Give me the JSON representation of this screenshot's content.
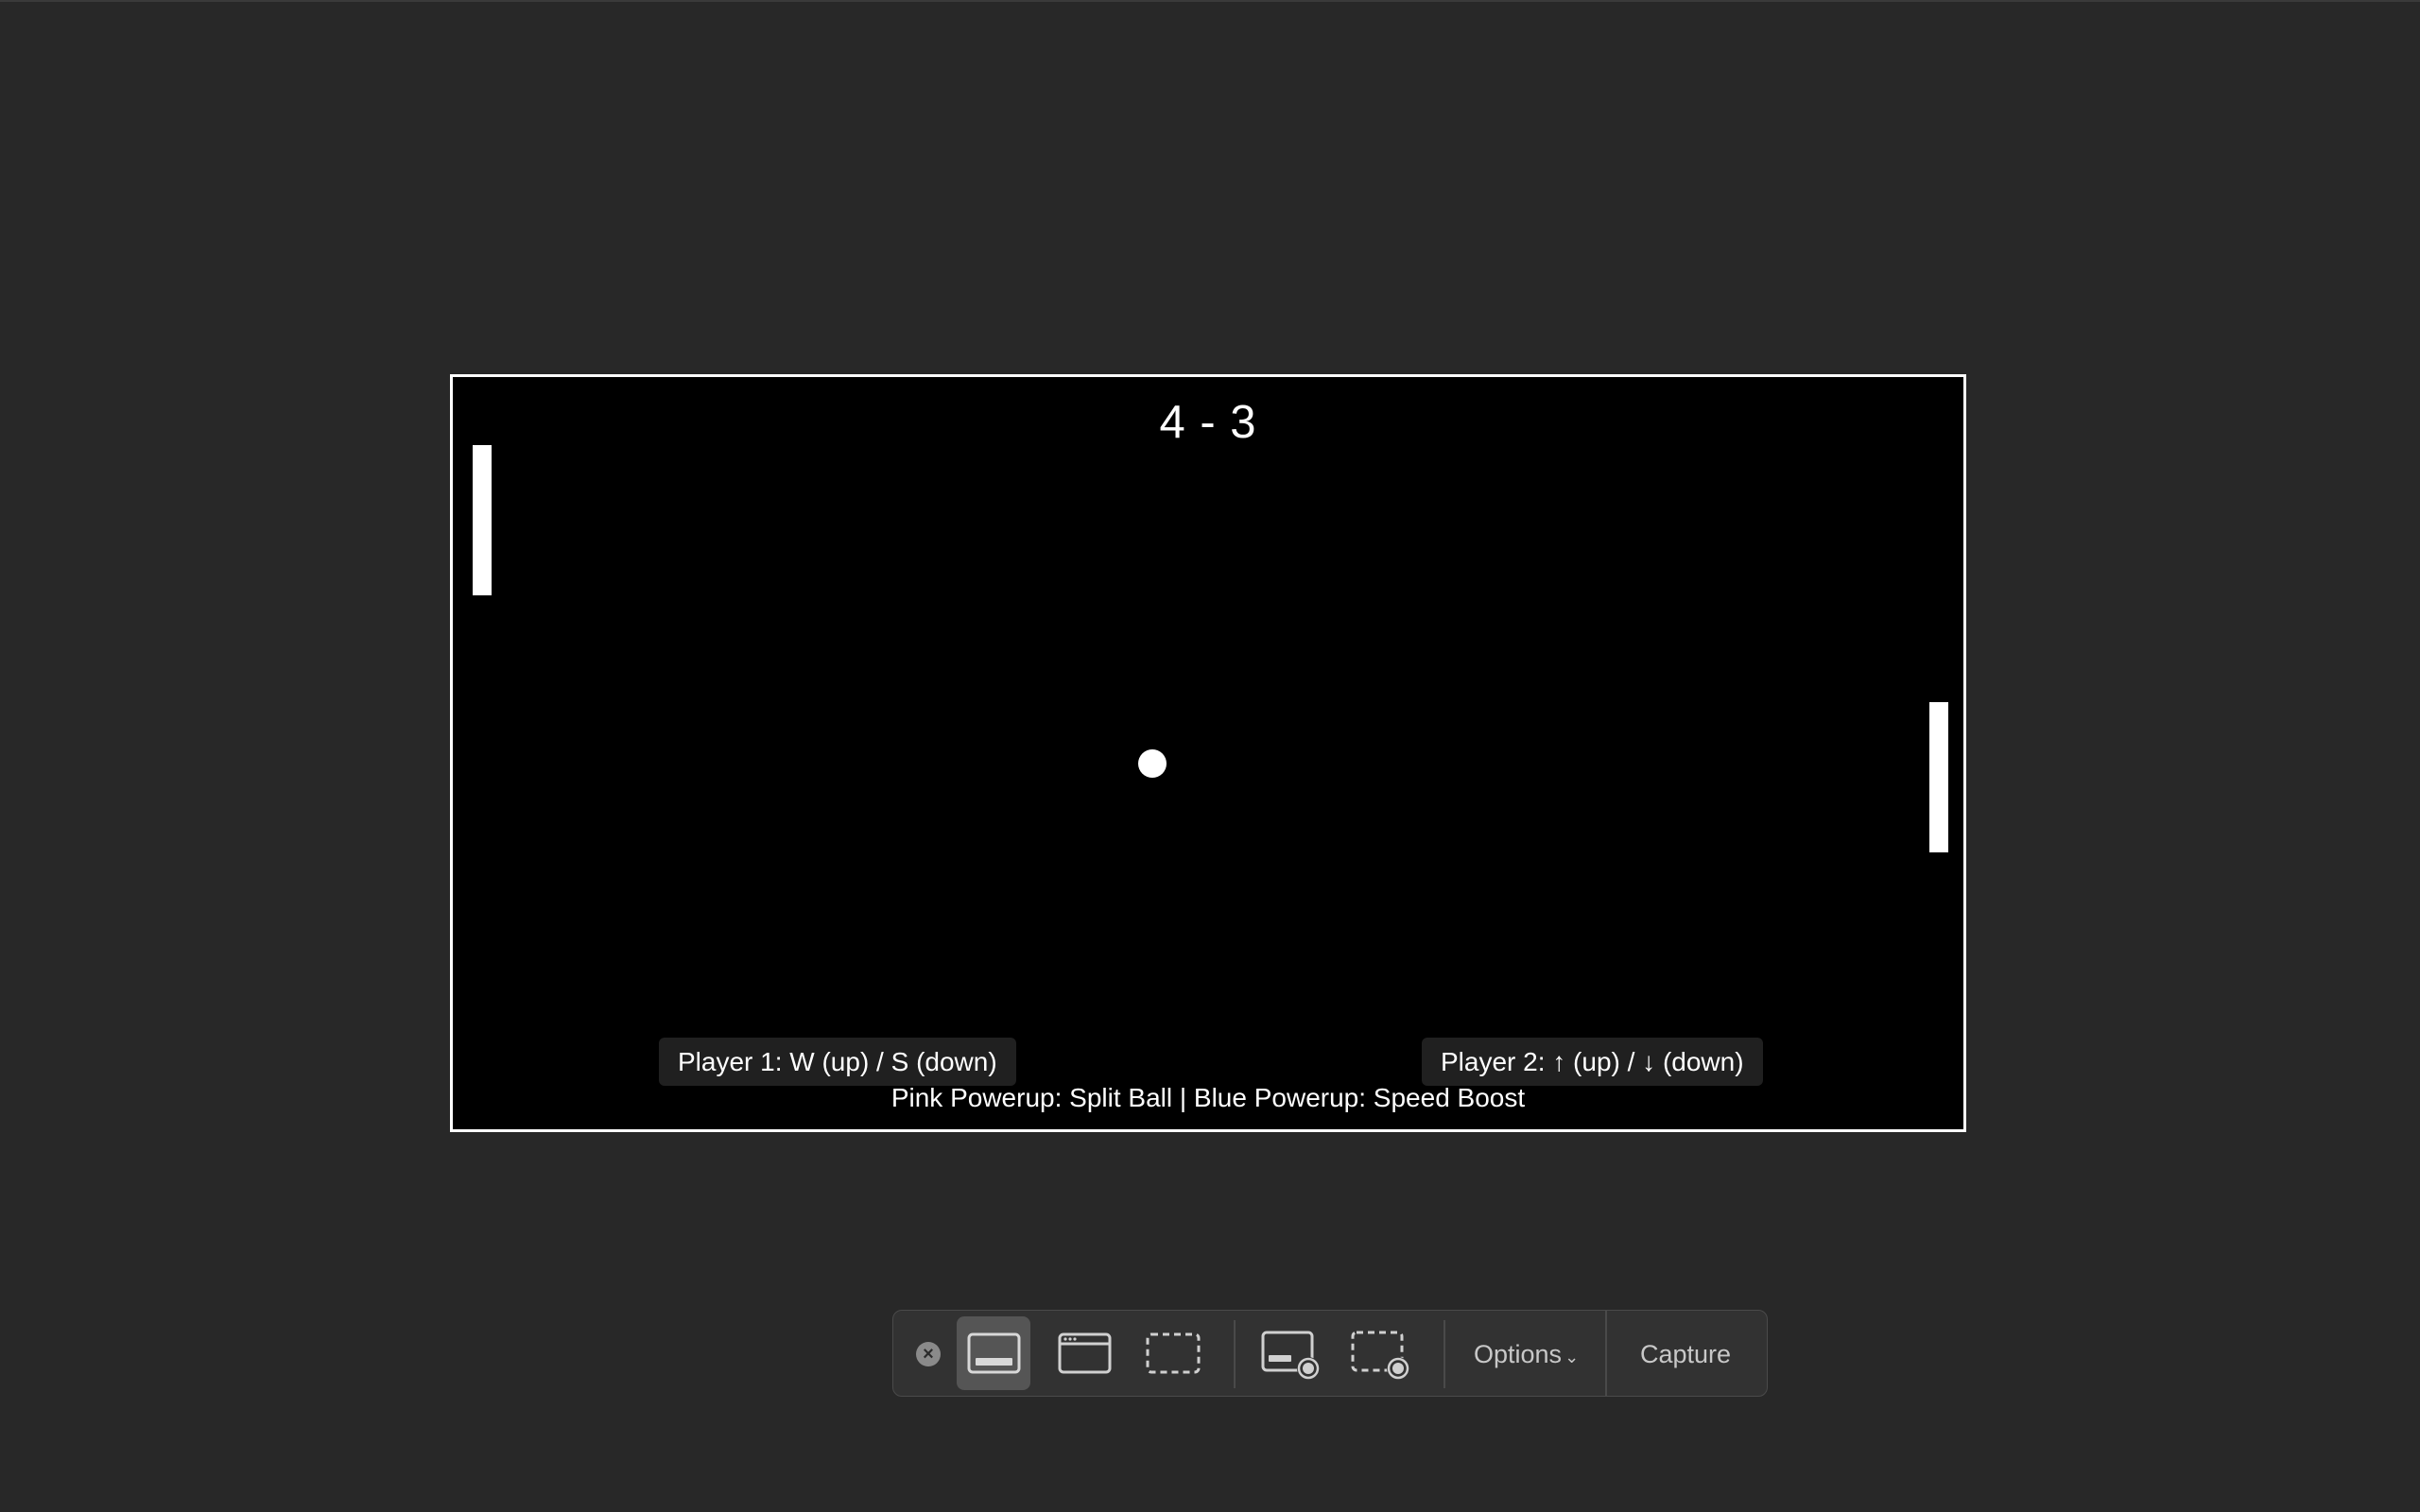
{
  "game": {
    "score": "4 - 3",
    "player1_controls": "Player 1: W (up) / S (down)",
    "player2_controls": "Player 2: ↑ (up) / ↓ (down)",
    "powerup_legend": "Pink Powerup: Split Ball | Blue Powerup: Speed Boost"
  },
  "toolbar": {
    "close_icon": "close-icon",
    "modes": [
      {
        "name": "capture-entire-screen",
        "icon": "screen-icon",
        "active": true
      },
      {
        "name": "capture-window",
        "icon": "window-icon",
        "active": false
      },
      {
        "name": "capture-selection",
        "icon": "selection-icon",
        "active": false
      },
      {
        "name": "record-entire-screen",
        "icon": "record-screen-icon",
        "active": false
      },
      {
        "name": "record-selection",
        "icon": "record-selection-icon",
        "active": false
      }
    ],
    "options_label": "Options",
    "capture_label": "Capture"
  },
  "colors": {
    "background": "#282828",
    "game_bg": "#000000",
    "foreground": "#ffffff",
    "toolbar_bg": "#323232",
    "toolbar_active": "#555555"
  }
}
